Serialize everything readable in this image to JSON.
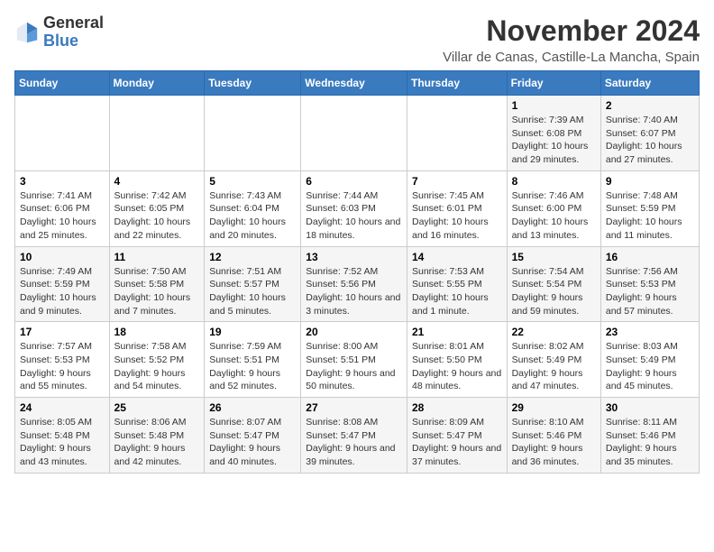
{
  "logo": {
    "line1": "General",
    "line2": "Blue"
  },
  "title": "November 2024",
  "location": "Villar de Canas, Castille-La Mancha, Spain",
  "weekdays": [
    "Sunday",
    "Monday",
    "Tuesday",
    "Wednesday",
    "Thursday",
    "Friday",
    "Saturday"
  ],
  "weeks": [
    [
      {
        "day": "",
        "sunrise": "",
        "sunset": "",
        "daylight": ""
      },
      {
        "day": "",
        "sunrise": "",
        "sunset": "",
        "daylight": ""
      },
      {
        "day": "",
        "sunrise": "",
        "sunset": "",
        "daylight": ""
      },
      {
        "day": "",
        "sunrise": "",
        "sunset": "",
        "daylight": ""
      },
      {
        "day": "",
        "sunrise": "",
        "sunset": "",
        "daylight": ""
      },
      {
        "day": "1",
        "sunrise": "Sunrise: 7:39 AM",
        "sunset": "Sunset: 6:08 PM",
        "daylight": "Daylight: 10 hours and 29 minutes."
      },
      {
        "day": "2",
        "sunrise": "Sunrise: 7:40 AM",
        "sunset": "Sunset: 6:07 PM",
        "daylight": "Daylight: 10 hours and 27 minutes."
      }
    ],
    [
      {
        "day": "3",
        "sunrise": "Sunrise: 7:41 AM",
        "sunset": "Sunset: 6:06 PM",
        "daylight": "Daylight: 10 hours and 25 minutes."
      },
      {
        "day": "4",
        "sunrise": "Sunrise: 7:42 AM",
        "sunset": "Sunset: 6:05 PM",
        "daylight": "Daylight: 10 hours and 22 minutes."
      },
      {
        "day": "5",
        "sunrise": "Sunrise: 7:43 AM",
        "sunset": "Sunset: 6:04 PM",
        "daylight": "Daylight: 10 hours and 20 minutes."
      },
      {
        "day": "6",
        "sunrise": "Sunrise: 7:44 AM",
        "sunset": "Sunset: 6:03 PM",
        "daylight": "Daylight: 10 hours and 18 minutes."
      },
      {
        "day": "7",
        "sunrise": "Sunrise: 7:45 AM",
        "sunset": "Sunset: 6:01 PM",
        "daylight": "Daylight: 10 hours and 16 minutes."
      },
      {
        "day": "8",
        "sunrise": "Sunrise: 7:46 AM",
        "sunset": "Sunset: 6:00 PM",
        "daylight": "Daylight: 10 hours and 13 minutes."
      },
      {
        "day": "9",
        "sunrise": "Sunrise: 7:48 AM",
        "sunset": "Sunset: 5:59 PM",
        "daylight": "Daylight: 10 hours and 11 minutes."
      }
    ],
    [
      {
        "day": "10",
        "sunrise": "Sunrise: 7:49 AM",
        "sunset": "Sunset: 5:59 PM",
        "daylight": "Daylight: 10 hours and 9 minutes."
      },
      {
        "day": "11",
        "sunrise": "Sunrise: 7:50 AM",
        "sunset": "Sunset: 5:58 PM",
        "daylight": "Daylight: 10 hours and 7 minutes."
      },
      {
        "day": "12",
        "sunrise": "Sunrise: 7:51 AM",
        "sunset": "Sunset: 5:57 PM",
        "daylight": "Daylight: 10 hours and 5 minutes."
      },
      {
        "day": "13",
        "sunrise": "Sunrise: 7:52 AM",
        "sunset": "Sunset: 5:56 PM",
        "daylight": "Daylight: 10 hours and 3 minutes."
      },
      {
        "day": "14",
        "sunrise": "Sunrise: 7:53 AM",
        "sunset": "Sunset: 5:55 PM",
        "daylight": "Daylight: 10 hours and 1 minute."
      },
      {
        "day": "15",
        "sunrise": "Sunrise: 7:54 AM",
        "sunset": "Sunset: 5:54 PM",
        "daylight": "Daylight: 9 hours and 59 minutes."
      },
      {
        "day": "16",
        "sunrise": "Sunrise: 7:56 AM",
        "sunset": "Sunset: 5:53 PM",
        "daylight": "Daylight: 9 hours and 57 minutes."
      }
    ],
    [
      {
        "day": "17",
        "sunrise": "Sunrise: 7:57 AM",
        "sunset": "Sunset: 5:53 PM",
        "daylight": "Daylight: 9 hours and 55 minutes."
      },
      {
        "day": "18",
        "sunrise": "Sunrise: 7:58 AM",
        "sunset": "Sunset: 5:52 PM",
        "daylight": "Daylight: 9 hours and 54 minutes."
      },
      {
        "day": "19",
        "sunrise": "Sunrise: 7:59 AM",
        "sunset": "Sunset: 5:51 PM",
        "daylight": "Daylight: 9 hours and 52 minutes."
      },
      {
        "day": "20",
        "sunrise": "Sunrise: 8:00 AM",
        "sunset": "Sunset: 5:51 PM",
        "daylight": "Daylight: 9 hours and 50 minutes."
      },
      {
        "day": "21",
        "sunrise": "Sunrise: 8:01 AM",
        "sunset": "Sunset: 5:50 PM",
        "daylight": "Daylight: 9 hours and 48 minutes."
      },
      {
        "day": "22",
        "sunrise": "Sunrise: 8:02 AM",
        "sunset": "Sunset: 5:49 PM",
        "daylight": "Daylight: 9 hours and 47 minutes."
      },
      {
        "day": "23",
        "sunrise": "Sunrise: 8:03 AM",
        "sunset": "Sunset: 5:49 PM",
        "daylight": "Daylight: 9 hours and 45 minutes."
      }
    ],
    [
      {
        "day": "24",
        "sunrise": "Sunrise: 8:05 AM",
        "sunset": "Sunset: 5:48 PM",
        "daylight": "Daylight: 9 hours and 43 minutes."
      },
      {
        "day": "25",
        "sunrise": "Sunrise: 8:06 AM",
        "sunset": "Sunset: 5:48 PM",
        "daylight": "Daylight: 9 hours and 42 minutes."
      },
      {
        "day": "26",
        "sunrise": "Sunrise: 8:07 AM",
        "sunset": "Sunset: 5:47 PM",
        "daylight": "Daylight: 9 hours and 40 minutes."
      },
      {
        "day": "27",
        "sunrise": "Sunrise: 8:08 AM",
        "sunset": "Sunset: 5:47 PM",
        "daylight": "Daylight: 9 hours and 39 minutes."
      },
      {
        "day": "28",
        "sunrise": "Sunrise: 8:09 AM",
        "sunset": "Sunset: 5:47 PM",
        "daylight": "Daylight: 9 hours and 37 minutes."
      },
      {
        "day": "29",
        "sunrise": "Sunrise: 8:10 AM",
        "sunset": "Sunset: 5:46 PM",
        "daylight": "Daylight: 9 hours and 36 minutes."
      },
      {
        "day": "30",
        "sunrise": "Sunrise: 8:11 AM",
        "sunset": "Sunset: 5:46 PM",
        "daylight": "Daylight: 9 hours and 35 minutes."
      }
    ]
  ]
}
